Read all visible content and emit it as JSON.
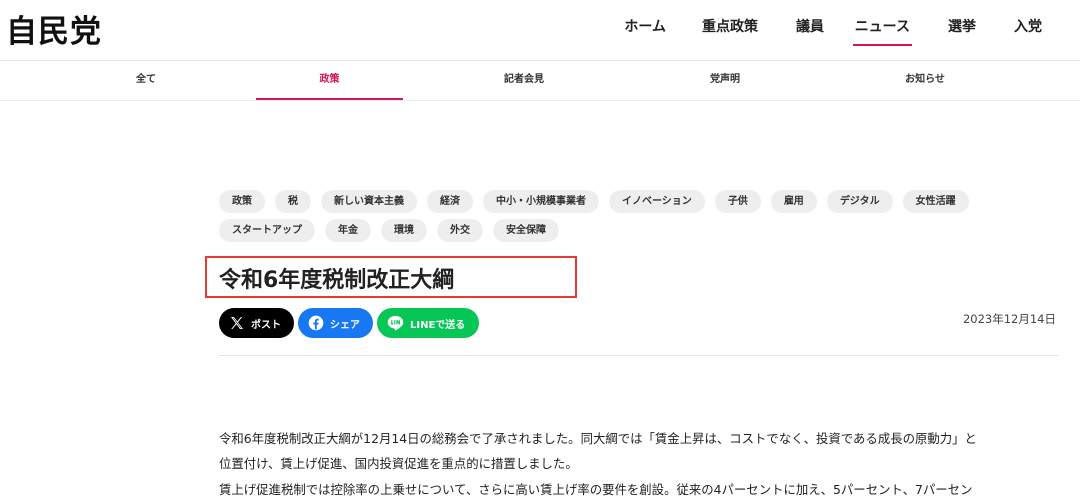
{
  "header": {
    "logo": "自民党",
    "nav": [
      {
        "label": "ホーム",
        "active": false
      },
      {
        "label": "重点政策",
        "active": false
      },
      {
        "label": "議員",
        "active": false
      },
      {
        "label": "ニュース",
        "active": true
      },
      {
        "label": "選挙",
        "active": false
      },
      {
        "label": "入党",
        "active": false
      }
    ]
  },
  "subnav": [
    {
      "label": "全て",
      "active": false
    },
    {
      "label": "政策",
      "active": true
    },
    {
      "label": "記者会見",
      "active": false
    },
    {
      "label": "党声明",
      "active": false
    },
    {
      "label": "お知らせ",
      "active": false
    }
  ],
  "tags": {
    "row1": [
      "政策",
      "税",
      "新しい資本主義",
      "経済",
      "中小・小規模事業者",
      "イノベーション",
      "子供",
      "雇用",
      "デジタル",
      "女性活躍"
    ],
    "row2": [
      "スタートアップ",
      "年金",
      "環境",
      "外交",
      "安全保障"
    ]
  },
  "article": {
    "title": "令和6年度税制改正大綱",
    "date": "2023年12月14日",
    "share": {
      "x": "ポスト",
      "facebook": "シェア",
      "line": "LINEで送る"
    },
    "colors": {
      "x": "#000000",
      "facebook": "#1877f2",
      "line": "#06c755",
      "accent": "#d4145a",
      "highlight": "#e53935"
    },
    "paragraphs": [
      "令和6年度税制改正大綱が12月14日の総務会で了承されました。同大綱では「賃金上昇は、コストでなく、投資である成長の原動力」と",
      "位置付け、賃上げ促進、国内投資促進を重点的に措置しました。",
      "賃上げ促進税制では控除率の上乗せについて、さらに高い賃上げ率の要件を創設。従来の4パーセントに加え、5パーセント、7パーセン"
    ]
  }
}
